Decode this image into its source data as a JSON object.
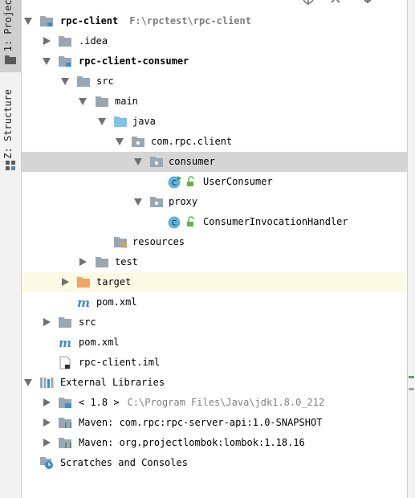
{
  "sidebar": {
    "project_tab": "1: Project",
    "structure_tab": "Z: Structure"
  },
  "tree": {
    "root": {
      "label": "rpc-client",
      "path": "F:\\rpctest\\rpc-client"
    },
    "idea": {
      "label": ".idea"
    },
    "consumer_module": {
      "label": "rpc-client-consumer"
    },
    "src_inner": {
      "label": "src"
    },
    "main": {
      "label": "main"
    },
    "java": {
      "label": "java"
    },
    "package": {
      "label": "com.rpc.client"
    },
    "consumer_pkg": {
      "label": "consumer"
    },
    "user_consumer": {
      "label": "UserConsumer"
    },
    "proxy_pkg": {
      "label": "proxy"
    },
    "handler": {
      "label": "ConsumerInvocationHandler"
    },
    "resources": {
      "label": "resources"
    },
    "test": {
      "label": "test"
    },
    "target": {
      "label": "target"
    },
    "pom_inner": {
      "label": "pom.xml"
    },
    "src_outer": {
      "label": "src"
    },
    "pom_outer": {
      "label": "pom.xml"
    },
    "iml": {
      "label": "rpc-client.iml"
    },
    "external_libraries": {
      "label": "External Libraries"
    },
    "jdk": {
      "label": "< 1.8 >",
      "path": "C:\\Program Files\\Java\\jdk1.8.0_212"
    },
    "maven_api": {
      "label": "Maven: com.rpc:rpc-server-api:1.0-SNAPSHOT"
    },
    "maven_lombok": {
      "label": "Maven: org.projectlombok:lombok:1.18.16"
    },
    "scratches": {
      "label": "Scratches and Consoles"
    }
  },
  "colors": {
    "folder": "#9aa7b0",
    "source_folder": "#7cc4e8",
    "excluded_folder": "#f3a465",
    "selection": "#d5d5d5",
    "excluded_row": "#fbfbe5",
    "class_icon": "#5fb4de",
    "maven_blue": "#3c8ec8"
  }
}
